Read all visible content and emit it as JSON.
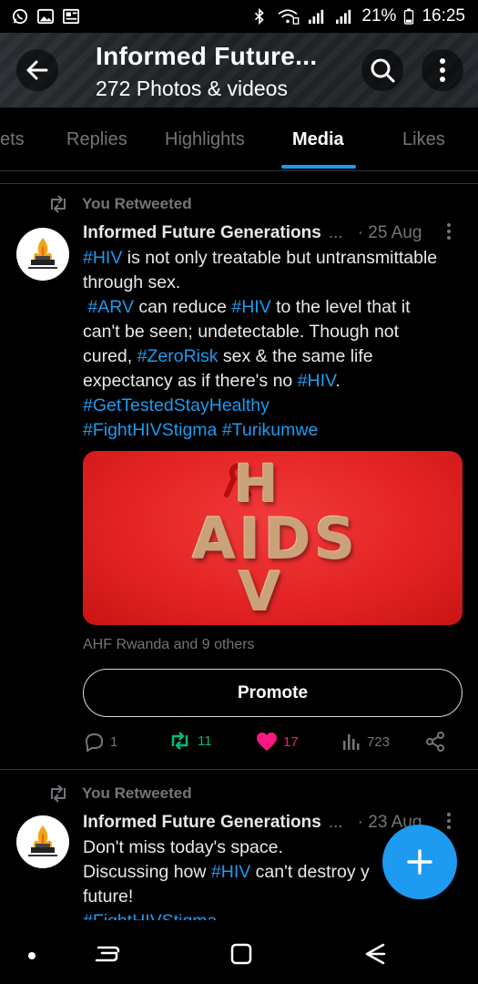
{
  "status_bar": {
    "left_icons": [
      "whatsapp-icon",
      "gallery-icon",
      "news-icon"
    ],
    "right_icons": [
      "bluetooth-icon",
      "wifi-icon",
      "signal-icon",
      "signal-icon",
      "battery-icon"
    ],
    "battery": "21%",
    "time": "16:25"
  },
  "header": {
    "title": "Informed Future...",
    "subtitle": "272 Photos & videos"
  },
  "tabs": [
    {
      "label": "ets"
    },
    {
      "label": "Replies"
    },
    {
      "label": "Highlights"
    },
    {
      "label": "Media",
      "active": true
    },
    {
      "label": "Likes"
    }
  ],
  "posts": [
    {
      "retweet_label": "You Retweeted",
      "author": "Informed Future Generations",
      "ellipsis": "...",
      "date": "· 25 Aug",
      "text_lines": [
        [
          {
            "t": "#HIV",
            "tag": true
          },
          {
            "t": " is not only treatable but untransmittable"
          }
        ],
        [
          {
            "t": "through sex."
          }
        ],
        [
          {
            "t": " "
          },
          {
            "t": "#ARV",
            "tag": true
          },
          {
            "t": " can reduce "
          },
          {
            "t": "#HIV",
            "tag": true
          },
          {
            "t": " to the level that it"
          }
        ],
        [
          {
            "t": "can't be seen; undetectable. Though not"
          }
        ],
        [
          {
            "t": "cured, "
          },
          {
            "t": "#ZeroRisk",
            "tag": true
          },
          {
            "t": " sex & the same life"
          }
        ],
        [
          {
            "t": "expectancy as if there's no "
          },
          {
            "t": "#HIV",
            "tag": true
          },
          {
            "t": "."
          }
        ],
        [
          {
            "t": "#GetTestedStayHealthy",
            "tag": true
          }
        ],
        [
          {
            "t": "#FightHIVStigma",
            "tag": true
          },
          {
            "t": " "
          },
          {
            "t": "#Turikumwe",
            "tag": true
          }
        ]
      ],
      "media_letters": {
        "top": "H",
        "middle": "AIDS",
        "bottom": "V"
      },
      "liked_by": "AHF Rwanda and 9 others",
      "promote_label": "Promote",
      "actions": {
        "replies": "1",
        "retweets": "11",
        "likes": "17",
        "views": "723"
      }
    },
    {
      "retweet_label": "You Retweeted",
      "author": "Informed Future Generations",
      "ellipsis": "...",
      "date": "· 23 Aug",
      "text_lines": [
        [
          {
            "t": "Don't miss today's space."
          }
        ],
        [
          {
            "t": "Discussing how "
          },
          {
            "t": "#HIV",
            "tag": true
          },
          {
            "t": " can't destroy y"
          }
        ],
        [
          {
            "t": "future!"
          }
        ],
        [
          {
            "t": "#FightHIVStigma",
            "tag": true
          }
        ]
      ]
    }
  ],
  "colors": {
    "accent": "#1d9bf0",
    "retweet_green": "#00ba7c",
    "like_pink": "#f91880",
    "muted": "#71767b",
    "media_red": "#e42424"
  }
}
